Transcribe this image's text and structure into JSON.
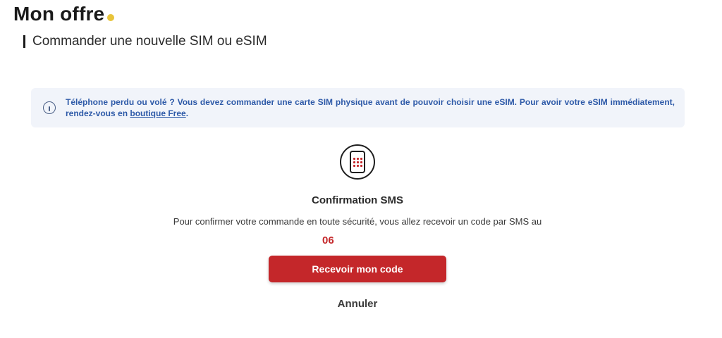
{
  "header": {
    "title": "Mon offre",
    "subtitle": "Commander une nouvelle SIM ou eSIM"
  },
  "info_banner": {
    "icon": "info-circle-icon",
    "text_before_link": "Téléphone perdu ou volé ? Vous devez commander une carte SIM physique avant de pouvoir choisir une eSIM. Pour avoir votre eSIM immédiatement, rendez-vous en ",
    "link_text": "boutique Free",
    "text_after_link": "."
  },
  "sms_confirmation": {
    "icon": "phone-keypad-icon",
    "heading": "Confirmation SMS",
    "description": "Pour confirmer votre commande en toute sécurité, vous allez recevoir un code par SMS au",
    "phone_number": "06"
  },
  "actions": {
    "receive_label": "Recevoir mon code",
    "cancel_label": "Annuler"
  },
  "colors": {
    "accent_red": "#c4272a",
    "title_dot_yellow": "#e8c43a",
    "banner_background": "#f1f4fa",
    "banner_text_blue": "#2e5aa8"
  }
}
